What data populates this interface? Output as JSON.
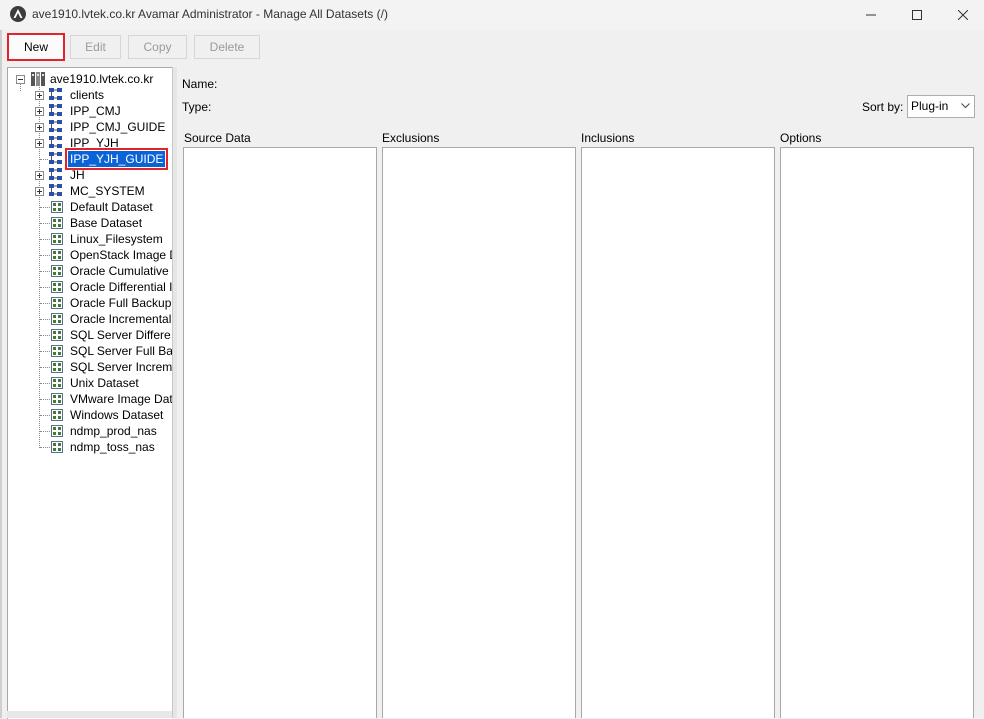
{
  "window": {
    "title": "ave1910.lvtek.co.kr Avamar Administrator - Manage All Datasets (/)",
    "app_icon": "avamar-logo-icon",
    "controls": [
      "minimize-icon",
      "maximize-icon",
      "close-icon"
    ]
  },
  "toolbar": {
    "new_label": "New",
    "edit_label": "Edit",
    "copy_label": "Copy",
    "delete_label": "Delete"
  },
  "tree": {
    "root": "ave1910.lvtek.co.kr",
    "domains": [
      {
        "label": "clients",
        "expanded": false
      },
      {
        "label": "IPP_CMJ",
        "expanded": false
      },
      {
        "label": "IPP_CMJ_GUIDE",
        "expanded": false
      },
      {
        "label": "IPP_YJH",
        "expanded": false
      },
      {
        "label": "IPP_YJH_GUIDE",
        "selected": true
      },
      {
        "label": "JH",
        "expanded": false
      },
      {
        "label": "MC_SYSTEM",
        "expanded": false
      }
    ],
    "datasets": [
      "Default Dataset",
      "Base Dataset",
      "Linux_Filesystem",
      "OpenStack Image D",
      "Oracle Cumulative I",
      "Oracle Differential I",
      "Oracle Full Backup",
      "Oracle Incremental",
      "SQL Server Differe",
      "SQL Server Full Ba",
      "SQL Server Increm",
      "Unix Dataset",
      "VMware Image Dat",
      "Windows Dataset",
      "ndmp_prod_nas",
      "ndmp_toss_nas"
    ]
  },
  "details": {
    "name_label": "Name:",
    "type_label": "Type:",
    "sort_by_label": "Sort by:",
    "sort_by_value": "Plug-in",
    "columns": [
      "Source Data",
      "Exclusions",
      "Inclusions",
      "Options"
    ]
  },
  "colors": {
    "selection": "#0a64d8",
    "highlight_outline": "#e0242b"
  }
}
